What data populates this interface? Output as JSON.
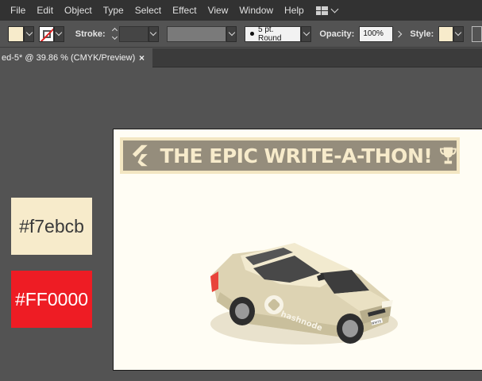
{
  "menu": {
    "items": [
      "File",
      "Edit",
      "Object",
      "Type",
      "Select",
      "Effect",
      "View",
      "Window",
      "Help"
    ]
  },
  "control_bar": {
    "fill_color": "#f7ebcb",
    "stroke_label": "Stroke:",
    "brush_label": "5 pt. Round",
    "opacity_label": "Opacity:",
    "opacity_value": "100%",
    "style_label": "Style:"
  },
  "document_tab": {
    "title": "ed-5* @ 39.86 % (CMYK/Preview)",
    "close_glyph": "×"
  },
  "swatches": [
    {
      "label": "#f7ebcb",
      "color": "#f7ebcb"
    },
    {
      "label": "#FF0000",
      "color": "#ee1c24"
    }
  ],
  "artboard": {
    "banner_title": "THE EPIC WRITE-A-THON!",
    "car_brand": "hashnode",
    "plate_text": "WRITE"
  }
}
